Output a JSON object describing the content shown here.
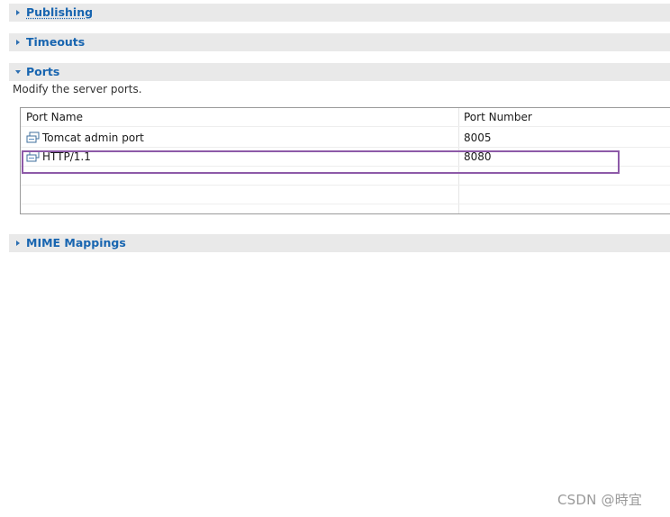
{
  "sections": {
    "publishing": {
      "label": "Publishing",
      "expanded": false
    },
    "timeouts": {
      "label": "Timeouts",
      "expanded": false
    },
    "ports": {
      "label": "Ports",
      "expanded": true,
      "description": "Modify the server ports.",
      "columns": [
        "Port Name",
        "Port Number"
      ],
      "rows": [
        {
          "name": "Tomcat admin port",
          "number": "8005",
          "icon": "port-icon"
        },
        {
          "name": "HTTP/1.1",
          "number": "8080",
          "icon": "port-icon"
        }
      ]
    },
    "mime": {
      "label": "MIME Mappings",
      "expanded": false
    }
  },
  "colors": {
    "section_title": "#1865b0",
    "section_bg": "#e9e9e9",
    "highlight": "#8d5aa8"
  },
  "watermark": "CSDN @時宜"
}
